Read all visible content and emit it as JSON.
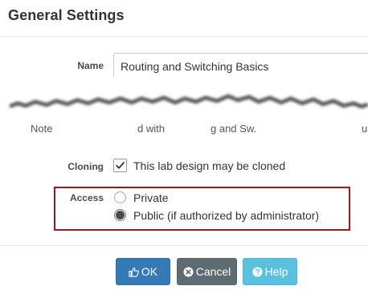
{
  "dialog": {
    "title": "General Settings"
  },
  "fields": {
    "name_label": "Name",
    "name_value": "Routing and Switching Basics",
    "cloning_label": "Cloning",
    "cloning_checked": true,
    "cloning_text": "This lab design may be cloned",
    "access_label": "Access",
    "access_options": [
      {
        "label": "Private",
        "checked": false
      },
      {
        "label": "Public (if authorized by administrator)",
        "checked": true
      }
    ]
  },
  "notes_fragment": {
    "parts": [
      "Note",
      "d with",
      "g and Sw.",
      "u"
    ]
  },
  "buttons": {
    "ok_label": "OK",
    "cancel_label": "Cancel",
    "help_label": "Help"
  },
  "colors": {
    "ok": "#337ab7",
    "cancel": "#5f6b72",
    "help": "#5bc0de",
    "highlight": "#a4161a"
  }
}
